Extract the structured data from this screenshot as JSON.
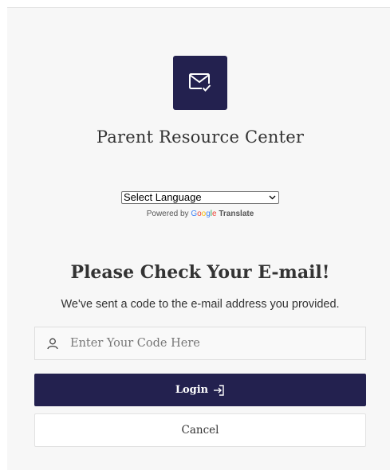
{
  "app": {
    "title": "Parent Resource Center",
    "logo_icon": "mail-check-icon",
    "brand_color": "#23214f"
  },
  "language": {
    "selected": "Select Language",
    "powered_prefix": "Powered by",
    "google": [
      "G",
      "o",
      "o",
      "g",
      "l",
      "e"
    ],
    "translate": "Translate"
  },
  "verify": {
    "heading": "Please Check Your E-mail!",
    "message": "We've sent a code to the e-mail address you provided.",
    "code_placeholder": "Enter Your Code Here",
    "code_value": "",
    "field_icon": "user-icon"
  },
  "actions": {
    "login_label": "Login",
    "login_icon": "sign-in-icon",
    "cancel_label": "Cancel"
  }
}
